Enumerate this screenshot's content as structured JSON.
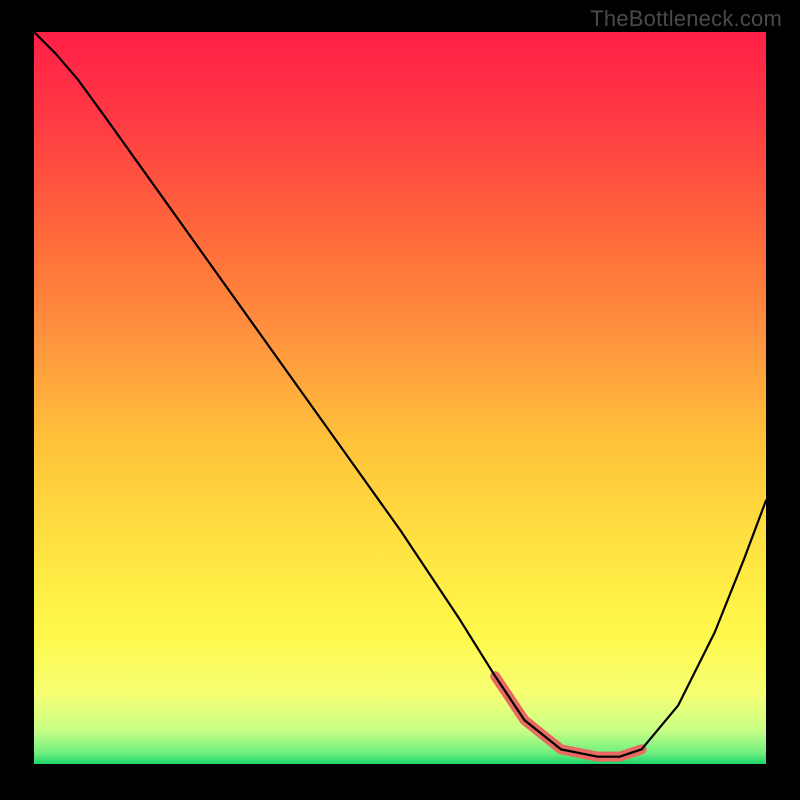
{
  "watermark": "TheBottleneck.com",
  "chart_data": {
    "type": "line",
    "title": "",
    "xlabel": "",
    "ylabel": "",
    "xlim": [
      0,
      100
    ],
    "ylim": [
      0,
      100
    ],
    "grid": false,
    "legend": false,
    "background": {
      "type": "vertical-gradient",
      "stops": [
        {
          "pos": 0.0,
          "color": "#ff1f46"
        },
        {
          "pos": 0.12,
          "color": "#ff3a44"
        },
        {
          "pos": 0.28,
          "color": "#ff6a3a"
        },
        {
          "pos": 0.42,
          "color": "#ff943e"
        },
        {
          "pos": 0.56,
          "color": "#ffc23a"
        },
        {
          "pos": 0.7,
          "color": "#ffe241"
        },
        {
          "pos": 0.82,
          "color": "#fff84a"
        },
        {
          "pos": 0.905,
          "color": "#f6ff74"
        },
        {
          "pos": 0.955,
          "color": "#c6ff86"
        },
        {
          "pos": 0.985,
          "color": "#6fef7f"
        },
        {
          "pos": 1.0,
          "color": "#1bd36b"
        }
      ]
    },
    "series": [
      {
        "name": "bottleneck-curve",
        "stroke": "#000000",
        "stroke_width": 2.2,
        "x": [
          0,
          3,
          6,
          10,
          20,
          30,
          40,
          50,
          58,
          63,
          67,
          72,
          77,
          80,
          83,
          88,
          93,
          97,
          100
        ],
        "y": [
          100,
          97,
          93.5,
          88,
          74,
          60,
          46,
          32,
          20,
          12,
          6,
          2,
          1,
          1,
          2,
          8,
          18,
          28,
          36
        ]
      }
    ],
    "highlight": {
      "name": "optimal-range",
      "stroke": "#e96a61",
      "stroke_width": 10,
      "linecap": "round",
      "x": [
        63,
        67,
        72,
        77,
        80,
        83
      ],
      "y": [
        12,
        6,
        2,
        1,
        1,
        2
      ]
    }
  }
}
